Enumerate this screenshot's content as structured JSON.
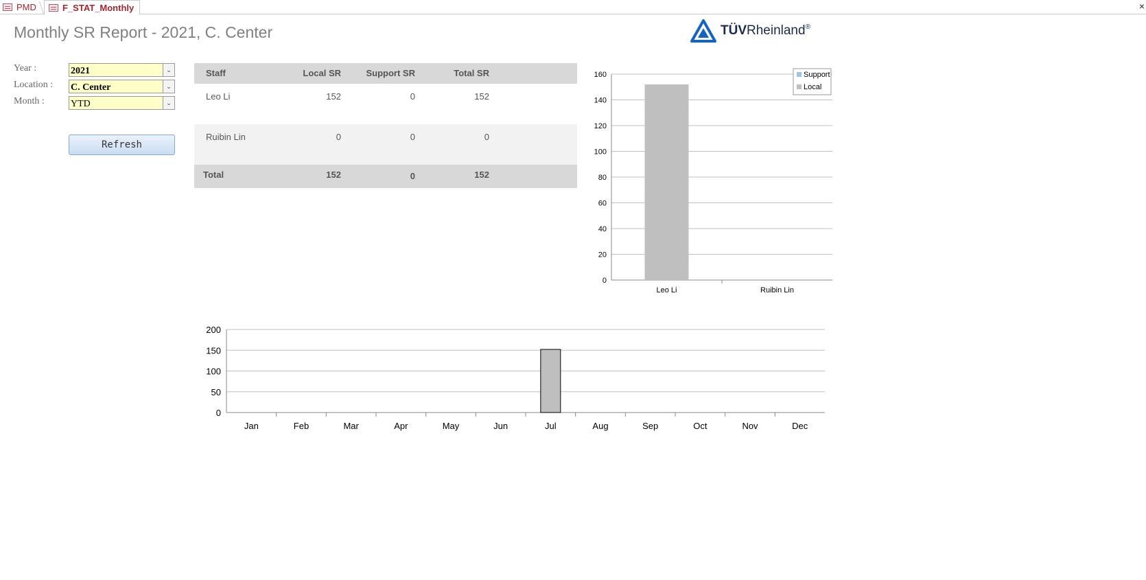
{
  "tabs": [
    {
      "label": "PMD"
    },
    {
      "label": "F_STAT_Monthly"
    }
  ],
  "close_symbol": "×",
  "header": {
    "title": "Monthly SR Report -  2021, C. Center",
    "logo_text_bold": "TÜV",
    "logo_text_rest": "Rheinland",
    "logo_reg": "®"
  },
  "filters": {
    "year_label": "Year :",
    "year_value": "2021",
    "location_label": "Location :",
    "location_value": "C. Center",
    "month_label": "Month :",
    "month_value": "YTD",
    "refresh_label": "Refresh"
  },
  "table": {
    "headers": [
      "Staff",
      "Local SR",
      "Support SR",
      "Total SR"
    ],
    "rows": [
      {
        "staff": "Leo Li",
        "local": "152",
        "support": "0",
        "total": "152"
      },
      {
        "staff": "Ruibin Lin",
        "local": "0",
        "support": "0",
        "total": "0"
      }
    ],
    "footer": {
      "staff": "Total",
      "local": "152",
      "support": "0",
      "total": "152"
    }
  },
  "colors": {
    "support": "#9dc3e6",
    "local": "#bfbfbf",
    "grid": "#c0c0c0",
    "input_bg": "#ffffc8",
    "tab_text": "#a4262c",
    "logo_blue": "#1565c0"
  },
  "chart_data": [
    {
      "type": "bar",
      "stacked": true,
      "categories": [
        "Leo Li",
        "Ruibin Lin"
      ],
      "series": [
        {
          "name": "Support",
          "values": [
            0,
            0
          ]
        },
        {
          "name": "Local",
          "values": [
            152,
            0
          ]
        }
      ],
      "ylim": [
        0,
        160
      ],
      "yticks": [
        0,
        20,
        40,
        60,
        80,
        100,
        120,
        140,
        160
      ],
      "grid": true,
      "legend": "top-right"
    },
    {
      "type": "bar",
      "categories": [
        "Jan",
        "Feb",
        "Mar",
        "Apr",
        "May",
        "Jun",
        "Jul",
        "Aug",
        "Sep",
        "Oct",
        "Nov",
        "Dec"
      ],
      "values": [
        0,
        0,
        0,
        0,
        0,
        0,
        152,
        0,
        0,
        0,
        0,
        0
      ],
      "ylim": [
        0,
        200
      ],
      "yticks": [
        0,
        50,
        100,
        150,
        200
      ],
      "grid": true
    }
  ]
}
